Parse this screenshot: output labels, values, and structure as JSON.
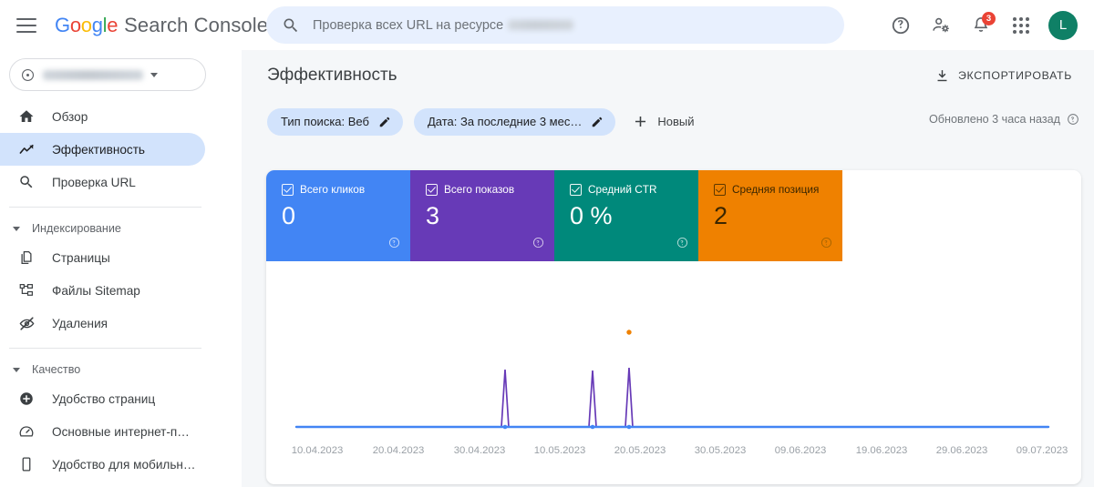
{
  "topbar": {
    "menu_icon": "hamburger-icon",
    "logo_google": "Google",
    "logo_product": "Search Console",
    "search": {
      "icon": "search-icon",
      "placeholder": "Проверка всех URL на ресурсе",
      "value": ""
    },
    "help_icon": "help-circle-icon",
    "account_settings_icon": "person-gear-icon",
    "notifications_icon": "bell-icon",
    "notifications_count": "3",
    "apps_icon": "apps-grid-icon",
    "avatar_letter": "L",
    "avatar_color": "#0f8066"
  },
  "sidebar": {
    "property_selector": {
      "icon": "property-globe-icon",
      "name": "",
      "caret_icon": "chevron-down-icon"
    },
    "items": [
      {
        "label": "Обзор",
        "icon": "home-icon",
        "active": false
      },
      {
        "label": "Эффективность",
        "icon": "trending-up-icon",
        "active": true
      },
      {
        "label": "Проверка URL",
        "icon": "search-icon",
        "active": false
      }
    ],
    "sections": [
      {
        "title": "Индексирование",
        "caret_icon": "caret-down-icon",
        "items": [
          {
            "label": "Страницы",
            "icon": "pages-copy-icon"
          },
          {
            "label": "Файлы Sitemap",
            "icon": "sitemap-icon"
          },
          {
            "label": "Удаления",
            "icon": "eye-off-icon"
          }
        ]
      },
      {
        "title": "Качество",
        "caret_icon": "caret-down-icon",
        "items": [
          {
            "label": "Удобство страниц",
            "icon": "page-experience-icon"
          },
          {
            "label": "Основные интернет-п…",
            "icon": "speedometer-icon"
          },
          {
            "label": "Удобство для мобильн…",
            "icon": "mobile-icon"
          }
        ]
      }
    ]
  },
  "main": {
    "page_title": "Эффективность",
    "export_button": {
      "label": "ЭКСПОРТИРОВАТЬ",
      "icon": "download-icon"
    },
    "filters": [
      {
        "label": "Тип поиска: Веб",
        "icon": "pencil-icon"
      },
      {
        "label": "Дата: За последние 3 мес…",
        "icon": "pencil-icon"
      }
    ],
    "new_filter": {
      "label": "Новый",
      "icon": "plus-icon"
    },
    "updated": {
      "text": "Обновлено 3 часа назад",
      "icon": "help-circle-icon"
    }
  },
  "metric_cards": [
    {
      "label": "Всего кликов",
      "value": "0",
      "color": "#4285f4",
      "checked": true,
      "help_icon": "help-circle-icon"
    },
    {
      "label": "Всего показов",
      "value": "3",
      "color": "#673ab7",
      "checked": true,
      "help_icon": "help-circle-icon"
    },
    {
      "label": "Средний CTR",
      "value": "0 %",
      "color": "#00897b",
      "checked": true,
      "help_icon": "help-circle-icon"
    },
    {
      "label": "Средняя позиция",
      "value": "2",
      "color": "#ef8100",
      "checked": true,
      "help_icon": "help-circle-icon"
    }
  ],
  "chart_data": {
    "type": "line",
    "title": "",
    "xlabel": "",
    "ylabel": "",
    "grid": false,
    "legend_position": "none",
    "x_tick_labels": [
      "10.04.2023",
      "20.04.2023",
      "30.04.2023",
      "10.05.2023",
      "20.05.2023",
      "30.05.2023",
      "09.06.2023",
      "19.06.2023",
      "29.06.2023",
      "09.07.2023"
    ],
    "x_range": [
      "04.04.2023",
      "09.07.2023"
    ],
    "series": [
      {
        "name": "Всего кликов",
        "color": "#4285f4",
        "type": "line",
        "values_note": "flat at zero across the whole range",
        "points": [
          {
            "x": "04.04.2023",
            "y": 0
          },
          {
            "x": "09.07.2023",
            "y": 0
          }
        ]
      },
      {
        "name": "Всего показов",
        "color": "#673ab7",
        "type": "line",
        "values_note": "three single-day spikes of 1 impression each, otherwise zero",
        "points": [
          {
            "x": "10.04.2023",
            "y": 0
          },
          {
            "x": "03.05.2023",
            "y": 0
          },
          {
            "x": "04.05.2023",
            "y": 1
          },
          {
            "x": "05.05.2023",
            "y": 0
          },
          {
            "x": "16.05.2023",
            "y": 0
          },
          {
            "x": "17.05.2023",
            "y": 1
          },
          {
            "x": "18.05.2023",
            "y": 0
          },
          {
            "x": "20.05.2023",
            "y": 0
          },
          {
            "x": "21.05.2023",
            "y": 1
          },
          {
            "x": "22.05.2023",
            "y": 0
          },
          {
            "x": "09.07.2023",
            "y": 0
          }
        ]
      },
      {
        "name": "Средняя позиция",
        "color": "#ef8100",
        "type": "scatter",
        "values_note": "single plotted point",
        "points": [
          {
            "x": "21.05.2023",
            "y": 2
          }
        ]
      }
    ]
  }
}
